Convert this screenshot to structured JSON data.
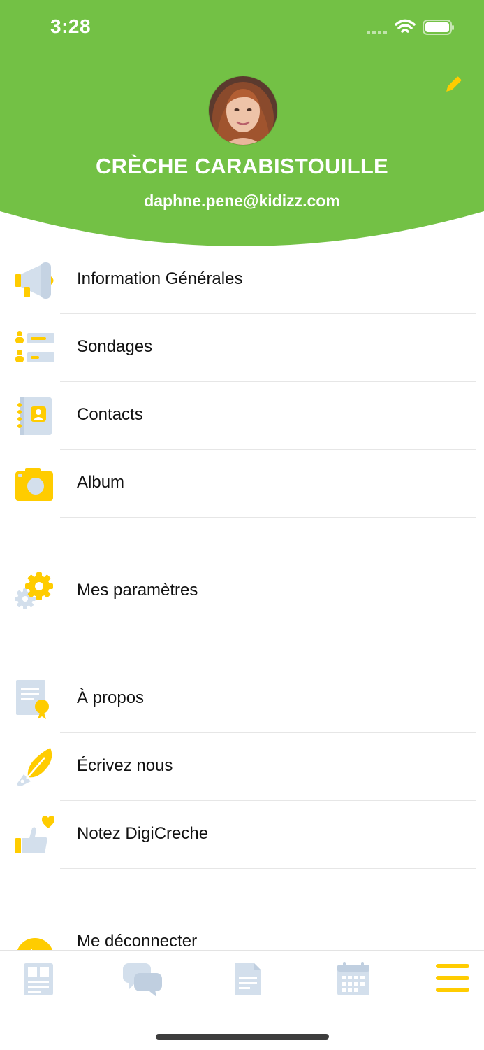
{
  "status_bar": {
    "time": "3:28"
  },
  "profile": {
    "org_name": "CRÈCHE CARABISTOUILLE",
    "email": "daphne.pene@kidizz.com"
  },
  "colors": {
    "header_green": "#73C145",
    "accent_yellow": "#FFCC00",
    "icon_blue": "#D3DFEC"
  },
  "menu": [
    {
      "label": "Information Générales",
      "icon": "megaphone-icon"
    },
    {
      "label": "Sondages",
      "icon": "survey-icon"
    },
    {
      "label": "Contacts",
      "icon": "contacts-book-icon"
    },
    {
      "label": "Album",
      "icon": "camera-icon"
    },
    {
      "label": "Mes paramètres",
      "icon": "gear-icon"
    },
    {
      "label": "À propos",
      "icon": "certificate-icon"
    },
    {
      "label": "Écrivez nous",
      "icon": "feather-pen-icon"
    },
    {
      "label": "Notez DigiCreche",
      "icon": "thumbs-up-heart-icon"
    },
    {
      "label": "Me déconnecter",
      "icon": "logout-icon"
    }
  ],
  "tabbar": [
    {
      "name": "news-tab",
      "icon": "news-icon"
    },
    {
      "name": "messages-tab",
      "icon": "chat-bubbles-icon"
    },
    {
      "name": "documents-tab",
      "icon": "document-icon"
    },
    {
      "name": "calendar-tab",
      "icon": "calendar-icon"
    },
    {
      "name": "menu-tab",
      "icon": "hamburger-icon",
      "active": true
    }
  ]
}
